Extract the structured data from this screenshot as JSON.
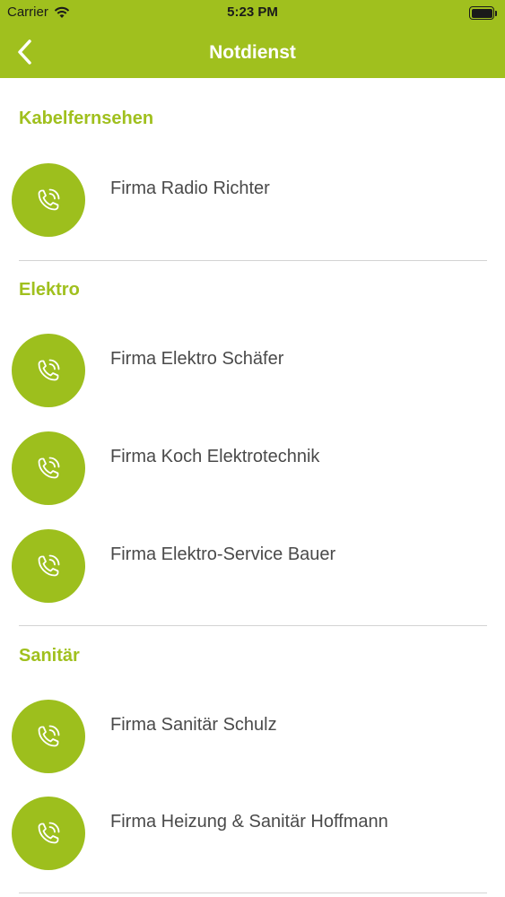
{
  "status_bar": {
    "carrier": "Carrier",
    "time": "5:23 PM",
    "wifi_icon": "wifi-icon",
    "battery_icon": "battery-icon"
  },
  "nav": {
    "title": "Notdienst",
    "back_icon": "chevron-left-icon"
  },
  "colors": {
    "brand_green": "#a0c01e",
    "text_gray": "#4a4a4a",
    "divider": "#d3d3d3"
  },
  "sections": [
    {
      "title": "Kabelfernsehen",
      "entries": [
        {
          "label": "Firma Radio Richter",
          "icon": "phone-call-icon"
        }
      ]
    },
    {
      "title": "Elektro",
      "entries": [
        {
          "label": "Firma Elektro Schäfer",
          "icon": "phone-call-icon"
        },
        {
          "label": "Firma Koch Elektrotechnik",
          "icon": "phone-call-icon"
        },
        {
          "label": "Firma Elektro-Service Bauer",
          "icon": "phone-call-icon"
        }
      ]
    },
    {
      "title": "Sanitär",
      "entries": [
        {
          "label": "Firma Sanitär Schulz",
          "icon": "phone-call-icon"
        },
        {
          "label": "Firma Heizung & Sanitär Hoffmann",
          "icon": "phone-call-icon"
        }
      ]
    }
  ]
}
